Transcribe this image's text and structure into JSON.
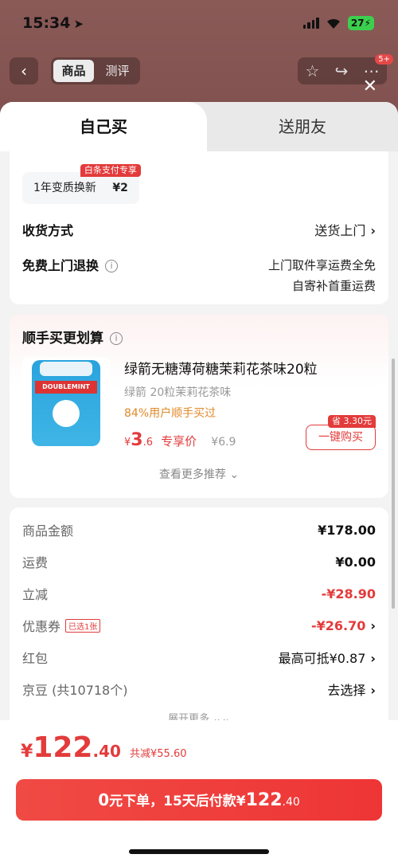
{
  "status": {
    "time": "15:34",
    "battery": "27"
  },
  "nav": {
    "tabs": [
      "商品",
      "测评"
    ],
    "badge": "5+"
  },
  "sheet": {
    "tabs": {
      "self": "自己买",
      "friend": "送朋友"
    },
    "service": {
      "name": "1年变质换新",
      "price": "¥2",
      "tag": "白条支付专享"
    },
    "delivery": {
      "label": "收货方式",
      "value": "送货上门"
    },
    "return": {
      "label": "免费上门退换",
      "line1": "上门取件享运费全免",
      "line2": "自寄补首重运费"
    }
  },
  "recommend": {
    "heading": "顺手买更划算",
    "title": "绿箭无糖薄荷糖茉莉花茶味20粒",
    "subtitle": "绿箭 20粒茉莉花茶味",
    "percent": "84%用户顺手买过",
    "price_symbol": "¥",
    "price_int": "3",
    "price_dec": ".6",
    "price_label": "专享价",
    "old_price": "¥6.9",
    "save_tag": "省 3.30元",
    "buy_label": "一键购买",
    "more": "查看更多推荐"
  },
  "fees": {
    "goods": {
      "label": "商品金额",
      "value": "¥178.00"
    },
    "shipping": {
      "label": "运费",
      "value": "¥0.00"
    },
    "discount": {
      "label": "立减",
      "value": "-¥28.90"
    },
    "coupon": {
      "label": "优惠券",
      "tag": "已选1张",
      "value": "-¥26.70"
    },
    "redpacket": {
      "label": "红包",
      "value": "最高可抵¥0.87"
    },
    "jingdou": {
      "label": "京豆 (共10718个)",
      "value": "去选择"
    },
    "expand": "展开更多"
  },
  "bottom": {
    "symbol": "¥",
    "total_int": "122",
    "total_dec": ".40",
    "saved": "共减¥55.60",
    "pay_prefix": "0",
    "pay_mid": "元下单，15天后付款¥",
    "pay_int": "122",
    "pay_dec": ".40"
  }
}
